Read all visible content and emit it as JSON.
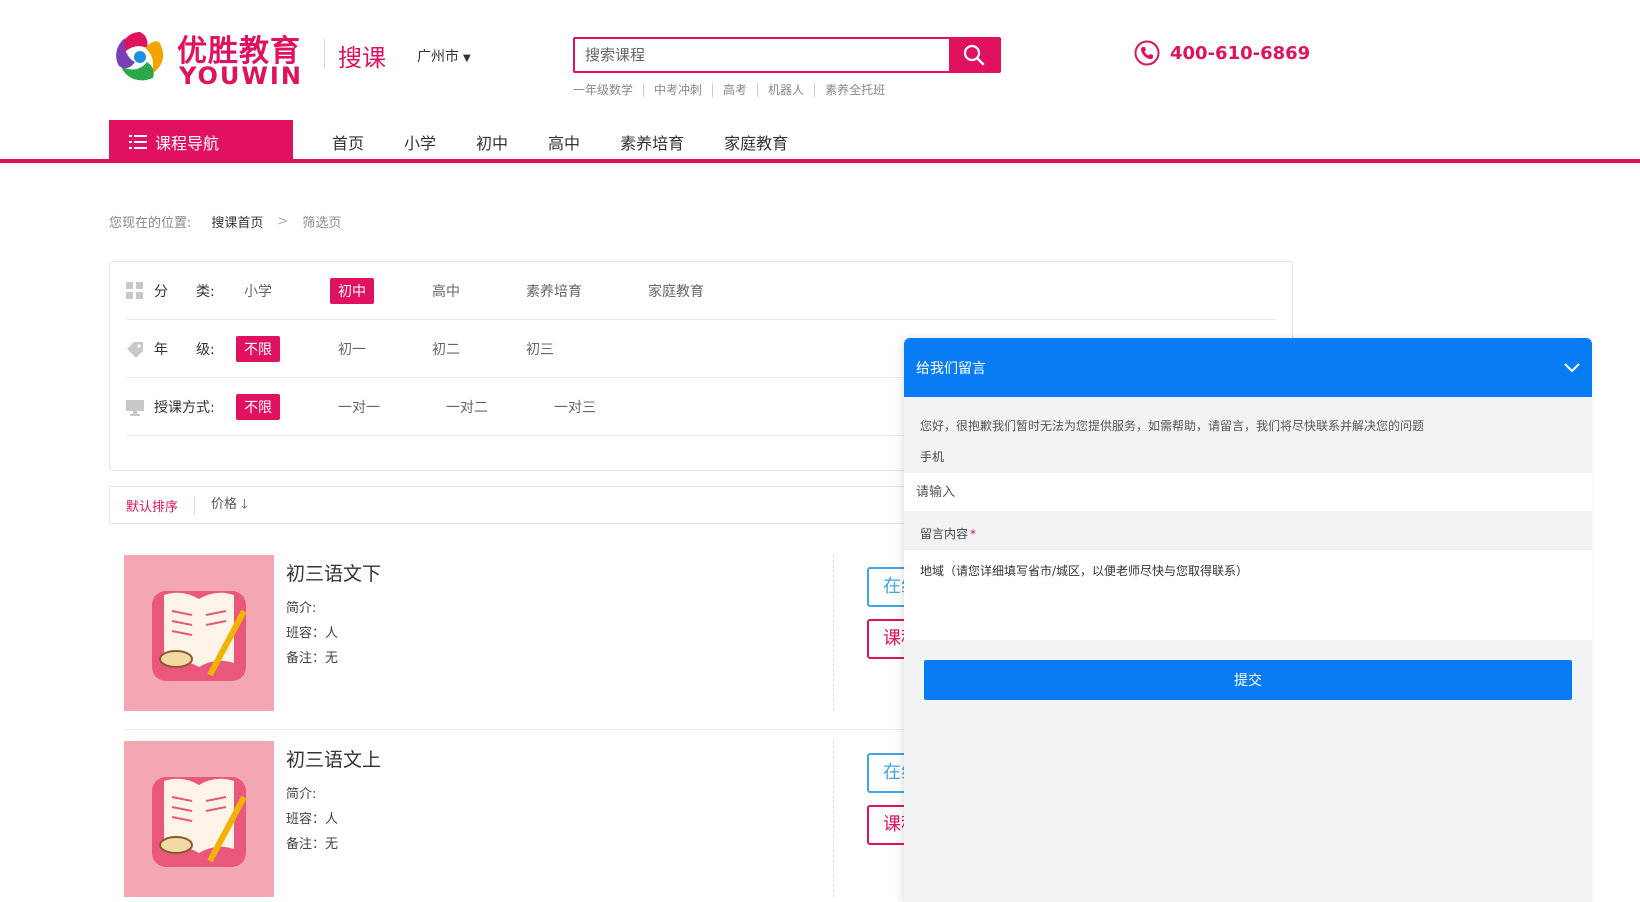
{
  "header": {
    "logo_cn": "优胜教育",
    "logo_en": "YOUWIN",
    "sub_title": "搜课",
    "city": "广州市",
    "search_placeholder": "搜索课程",
    "hot_links": [
      "一年级数学",
      "中考冲刺",
      "高考",
      "机器人",
      "素养全托班"
    ],
    "phone": "400-610-6869"
  },
  "nav": {
    "category_label": "课程导航",
    "items": [
      "首页",
      "小学",
      "初中",
      "高中",
      "素养培育",
      "家庭教育"
    ]
  },
  "breadcrumb": {
    "prefix": "您现在的位置:",
    "home": "搜课首页",
    "current": "筛选页"
  },
  "filters": {
    "category": {
      "label": "分　　类:",
      "options": [
        "小学",
        "初中",
        "高中",
        "素养培育",
        "家庭教育"
      ],
      "active": 1
    },
    "grade": {
      "label": "年　　级:",
      "options": [
        "不限",
        "初一",
        "初二",
        "初三"
      ],
      "active": 0
    },
    "mode": {
      "label": "授课方式:",
      "options": [
        "不限",
        "一对一",
        "一对二",
        "一对三"
      ],
      "active": 0
    }
  },
  "sort": {
    "default": "默认排序",
    "price": "价格"
  },
  "courses": [
    {
      "title": "初三语文下",
      "intro": "简介:",
      "class": "班容：人",
      "note": "备注：无",
      "btn_online": "在线",
      "btn_course": "课程"
    },
    {
      "title": "初三语文上",
      "intro": "简介:",
      "class": "班容：人",
      "note": "备注：无",
      "btn_online": "在线",
      "btn_course": "课程"
    }
  ],
  "message_panel": {
    "title": "给我们留言",
    "tip": "您好，很抱歉我们暂时无法为您提供服务，如需帮助，请留言，我们将尽快联系并解决您的问题",
    "phone_label": "手机",
    "phone_placeholder": "请输入",
    "content_label": "留言内容",
    "content_required": "*",
    "content_placeholder": "地域（请您详细填写省市/城区，以便老师尽快与您取得联系）",
    "submit": "提交"
  },
  "colors": {
    "brand": "#e0125f",
    "panel_blue": "#0a7cf3"
  }
}
